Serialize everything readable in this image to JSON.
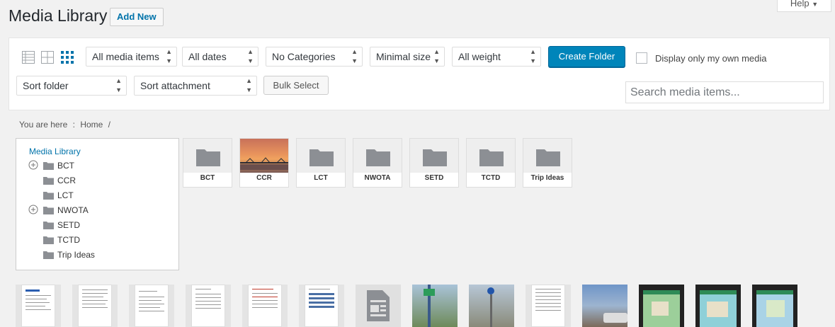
{
  "header": {
    "title": "Media Library",
    "add_new": "Add New",
    "help": "Help"
  },
  "toolbar": {
    "filters": [
      "All media items",
      "All dates",
      "No Categories",
      "Minimal size",
      "All weight"
    ],
    "create_folder": "Create Folder",
    "own_media_label": "Display only my own media",
    "sort_folder": "Sort folder",
    "sort_attachment": "Sort attachment",
    "bulk_select": "Bulk Select",
    "search_placeholder": "Search media items..."
  },
  "breadcrumb": {
    "prefix": "You are here",
    "separator": ":",
    "home": "Home",
    "trail_end": "/"
  },
  "tree": {
    "root": "Media Library",
    "items": [
      {
        "label": "BCT",
        "expandable": true
      },
      {
        "label": "CCR",
        "expandable": false
      },
      {
        "label": "LCT",
        "expandable": false
      },
      {
        "label": "NWOTA",
        "expandable": true
      },
      {
        "label": "SETD",
        "expandable": false
      },
      {
        "label": "TCTD",
        "expandable": false
      },
      {
        "label": "Trip Ideas",
        "expandable": false
      }
    ]
  },
  "folders": [
    "BCT",
    "CCR",
    "LCT",
    "NWOTA",
    "SETD",
    "TCTD",
    "Trip Ideas"
  ],
  "colors": {
    "primary": "#0085ba",
    "link": "#0073aa",
    "folder_icon": "#8c8f94"
  },
  "icons": {
    "list_view": "list-view-icon",
    "grid_view": "grid-view-icon",
    "tile_view": "tile-view-icon",
    "folder": "folder-icon",
    "expand": "plus-circle-icon",
    "document": "document-icon"
  }
}
